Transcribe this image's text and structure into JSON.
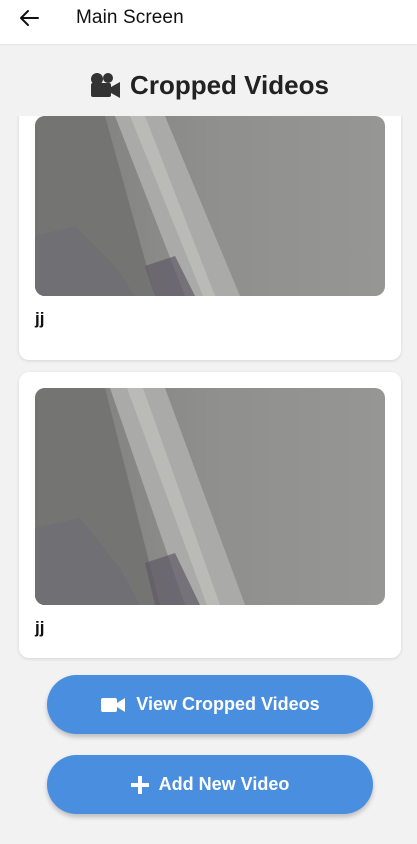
{
  "app_bar": {
    "title": "Main Screen",
    "back_icon": "arrow-left-icon"
  },
  "section": {
    "title": "Cropped Videos",
    "icon": "video-camera-icon"
  },
  "videos": [
    {
      "label": "jj"
    },
    {
      "label": "jj"
    }
  ],
  "buttons": {
    "view_cropped": {
      "label": "View Cropped Videos",
      "icon": "video-icon"
    },
    "add_new": {
      "label": "Add New Video",
      "icon": "plus-icon"
    }
  },
  "colors": {
    "accent": "#4a8ee0",
    "background": "#f2f2f2",
    "card": "#ffffff"
  }
}
